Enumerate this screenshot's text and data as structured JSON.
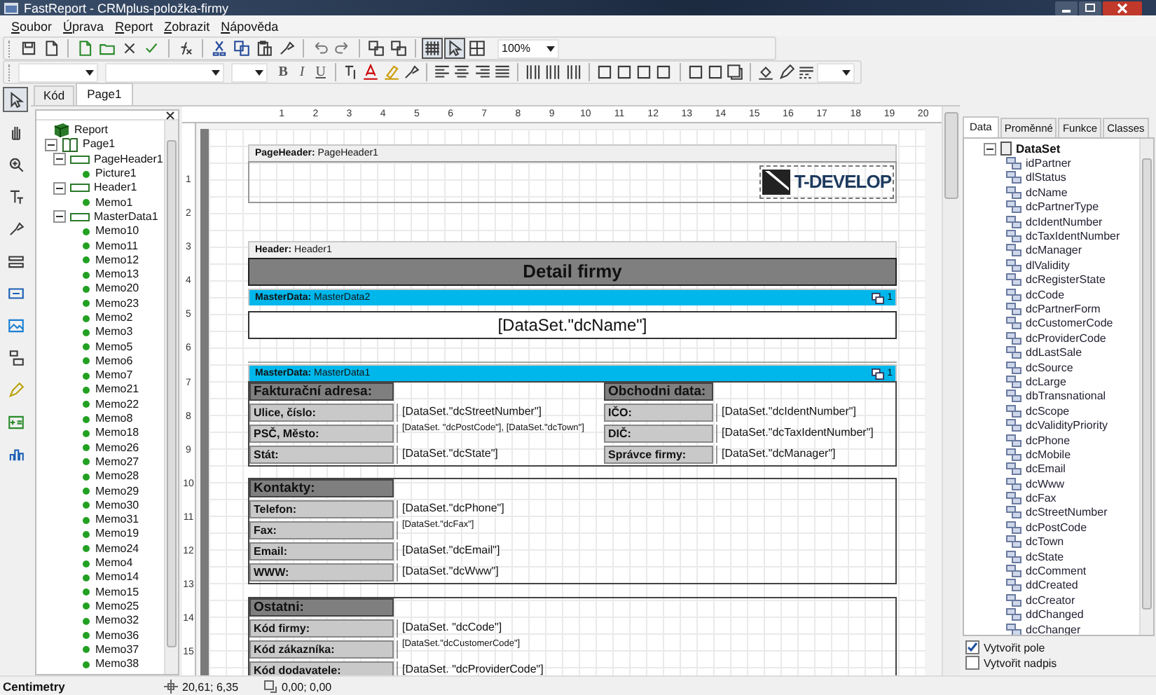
{
  "window": {
    "title": "FastReport - CRMplus-položka-firmy"
  },
  "menu": [
    "Soubor",
    "Úprava",
    "Report",
    "Zobrazit",
    "Nápověda"
  ],
  "toolbar": {
    "zoom": "100%",
    "toggles": [
      {
        "selected": true
      },
      {
        "selected": true
      },
      {
        "selected": false
      }
    ]
  },
  "format_toolbar": {
    "style_buttons": [
      "B",
      "I",
      "U"
    ]
  },
  "tools": [
    {
      "selected": true
    },
    {
      "selected": false
    },
    {
      "selected": false
    },
    {
      "selected": false
    },
    {
      "selected": false
    },
    {
      "selected": false
    },
    {
      "selected": false
    },
    {
      "selected": false
    },
    {
      "selected": false
    },
    {
      "selected": false
    },
    {
      "selected": false
    },
    {
      "selected": false
    }
  ],
  "designer_tabs": [
    {
      "label": "Kód",
      "selected": false
    },
    {
      "label": "Page1",
      "selected": true
    }
  ],
  "report_tree": {
    "label": "Report",
    "kind": "report",
    "children": [
      {
        "label": "Page1",
        "kind": "page",
        "expanded": true,
        "children": [
          {
            "label": "PageHeader1",
            "kind": "band",
            "expanded": true,
            "children": [
              {
                "label": "Picture1",
                "kind": "object"
              }
            ]
          },
          {
            "label": "Header1",
            "kind": "band",
            "expanded": true,
            "children": [
              {
                "label": "Memo1",
                "kind": "object"
              }
            ]
          },
          {
            "label": "MasterData1",
            "kind": "band",
            "expanded": true,
            "children": [
              {
                "label": "Memo10",
                "kind": "object"
              },
              {
                "label": "Memo11",
                "kind": "object"
              },
              {
                "label": "Memo12",
                "kind": "object"
              },
              {
                "label": "Memo13",
                "kind": "object"
              },
              {
                "label": "Memo20",
                "kind": "object"
              },
              {
                "label": "Memo23",
                "kind": "object"
              },
              {
                "label": "Memo2",
                "kind": "object"
              },
              {
                "label": "Memo3",
                "kind": "object"
              },
              {
                "label": "Memo5",
                "kind": "object"
              },
              {
                "label": "Memo6",
                "kind": "object"
              },
              {
                "label": "Memo7",
                "kind": "object"
              },
              {
                "label": "Memo21",
                "kind": "object"
              },
              {
                "label": "Memo22",
                "kind": "object"
              },
              {
                "label": "Memo8",
                "kind": "object"
              },
              {
                "label": "Memo18",
                "kind": "object"
              },
              {
                "label": "Memo26",
                "kind": "object"
              },
              {
                "label": "Memo27",
                "kind": "object"
              },
              {
                "label": "Memo28",
                "kind": "object"
              },
              {
                "label": "Memo29",
                "kind": "object"
              },
              {
                "label": "Memo30",
                "kind": "object"
              },
              {
                "label": "Memo31",
                "kind": "object"
              },
              {
                "label": "Memo19",
                "kind": "object"
              },
              {
                "label": "Memo24",
                "kind": "object"
              },
              {
                "label": "Memo4",
                "kind": "object"
              },
              {
                "label": "Memo14",
                "kind": "object"
              },
              {
                "label": "Memo15",
                "kind": "object"
              },
              {
                "label": "Memo25",
                "kind": "object"
              },
              {
                "label": "Memo32",
                "kind": "object"
              },
              {
                "label": "Memo36",
                "kind": "object"
              },
              {
                "label": "Memo37",
                "kind": "object"
              },
              {
                "label": "Memo38",
                "kind": "object"
              }
            ]
          }
        ]
      }
    ]
  },
  "ruler": {
    "horizontal": [
      "1",
      "2",
      "3",
      "4",
      "5",
      "6",
      "7",
      "8",
      "9",
      "10",
      "11",
      "12",
      "13",
      "14",
      "15",
      "16",
      "17",
      "18",
      "19",
      "20"
    ],
    "vertical": [
      "1",
      "2",
      "3",
      "4",
      "5",
      "6",
      "7",
      "8",
      "9",
      "10",
      "11",
      "12",
      "13",
      "14",
      "15"
    ]
  },
  "page": {
    "bands": [
      {
        "kind": "page-header",
        "label": "**PageHeader:** PageHeader1",
        "logo": "T-DEVELOP"
      },
      {
        "kind": "header",
        "label": "**Header:** Header1",
        "title": "Detail firmy"
      },
      {
        "kind": "master-data",
        "label": "**MasterData:** MasterData2",
        "count": "1",
        "field": "[DataSet.\"dcName\"]"
      },
      {
        "kind": "master-data",
        "label": "**MasterData:** MasterData1",
        "count": "1",
        "sections": [
          {
            "columns": [
              {
                "heading": "Fakturační adresa:",
                "rows": [
                  {
                    "label": "Ulice, číslo:",
                    "value": "[DataSet.\"dcStreetNumber\"]"
                  },
                  {
                    "label": "PSČ, Město:",
                    "value": "[DataSet. \"dcPostCode\"], [DataSet.\"dcTown\"]"
                  },
                  {
                    "label": "Stát:",
                    "value": "[DataSet.\"dcState\"]"
                  }
                ]
              },
              {
                "heading": "Obchodni data:",
                "rows": [
                  {
                    "label": "IČO:",
                    "value": "[DataSet.\"dcIdentNumber\"]"
                  },
                  {
                    "label": "DIČ:",
                    "value": "[DataSet.\"dcTaxIdentNumber\"]"
                  },
                  {
                    "label": "Správce firmy:",
                    "value": "[DataSet.\"dcManager\"]"
                  }
                ]
              }
            ]
          },
          {
            "columns": [
              {
                "heading": "Kontakty:",
                "rows": [
                  {
                    "label": "Telefon:",
                    "value": "[DataSet.\"dcPhone\"]"
                  },
                  {
                    "label": "Fax:",
                    "value": "[DataSet.\"dcFax\"]"
                  },
                  {
                    "label": "Email:",
                    "value": "[DataSet.\"dcEmail\"]"
                  },
                  {
                    "label": "WWW:",
                    "value": "[DataSet.\"dcWww\"]"
                  }
                ]
              }
            ]
          },
          {
            "columns": [
              {
                "heading": "Ostatni:",
                "rows": [
                  {
                    "label": "Kód firmy:",
                    "value": "[DataSet. \"dcCode\"]"
                  },
                  {
                    "label": "Kód zákazníka:",
                    "value": "[DataSet.\"dcCustomerCode\"]"
                  },
                  {
                    "label": "Kód dodavatele:",
                    "value": "[DataSet. \"dcProviderCode\"]"
                  }
                ]
              }
            ]
          }
        ]
      }
    ]
  },
  "data_panel": {
    "tabs": [
      {
        "label": "Data",
        "selected": true
      },
      {
        "label": "Proměnné",
        "selected": false
      },
      {
        "label": "Funkce",
        "selected": false
      },
      {
        "label": "Classes",
        "selected": false
      }
    ],
    "tree": {
      "label": "DataSet",
      "expanded": true,
      "fields": [
        "idPartner",
        "dlStatus",
        "dcName",
        "dcPartnerType",
        "dcIdentNumber",
        "dcTaxIdentNumber",
        "dcManager",
        "dlValidity",
        "dcRegisterState",
        "dcCode",
        "dcPartnerForm",
        "dcCustomerCode",
        "dcProviderCode",
        "ddLastSale",
        "dcSource",
        "dcLarge",
        "dbTransnational",
        "dcScope",
        "dcValidityPriority",
        "dcPhone",
        "dcMobile",
        "dcEmail",
        "dcWww",
        "dcFax",
        "dcStreetNumber",
        "dcPostCode",
        "dcTown",
        "dcState",
        "dcComment",
        "ddCreated",
        "dcCreator",
        "ddChanged",
        "dcChanger"
      ]
    },
    "options": [
      {
        "label": "Vytvořit pole",
        "checked": true
      },
      {
        "label": "Vytvořit nadpis",
        "checked": false
      }
    ]
  },
  "status_bar": {
    "units": "Centimetry",
    "position": "20,61; 6,35",
    "size": "0,00; 0,00"
  }
}
